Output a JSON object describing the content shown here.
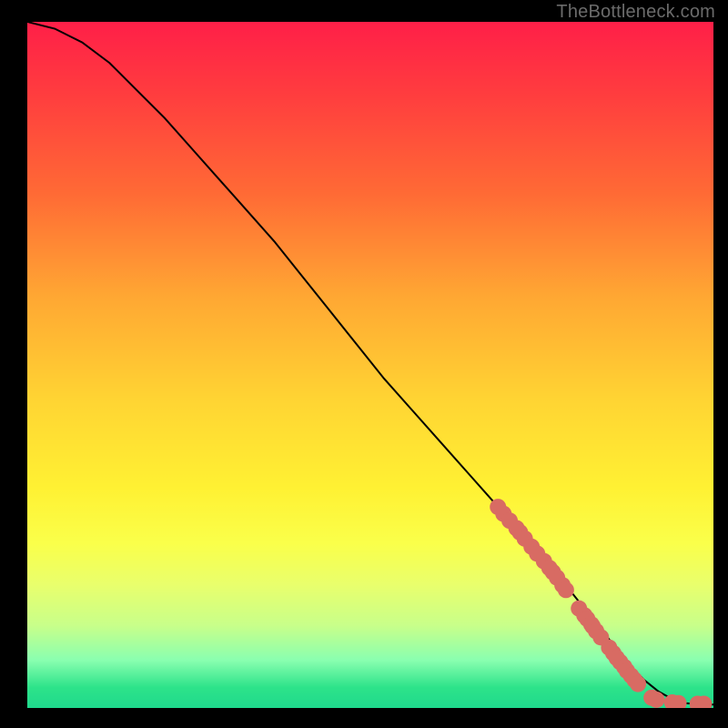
{
  "attribution": "TheBottleneck.com",
  "chart_data": {
    "type": "line",
    "title": "",
    "xlabel": "",
    "ylabel": "",
    "xlim": [
      0,
      100
    ],
    "ylim": [
      0,
      100
    ],
    "grid": false,
    "series": [
      {
        "name": "curve",
        "color": "#000000",
        "x": [
          0,
          4,
          8,
          12,
          16,
          20,
          24,
          28,
          32,
          36,
          40,
          44,
          48,
          52,
          56,
          60,
          64,
          68,
          72,
          76,
          80,
          82,
          84,
          86,
          88,
          90,
          92,
          94,
          96,
          98,
          100
        ],
        "y": [
          100,
          99,
          97,
          94,
          90,
          86,
          81.5,
          77,
          72.5,
          68,
          63,
          58,
          53,
          48,
          43.5,
          39,
          34.5,
          30,
          25.5,
          21,
          16,
          13.5,
          11,
          8.5,
          6,
          4,
          2.4,
          1.3,
          0.7,
          0.5,
          0.5
        ]
      }
    ],
    "points": [
      {
        "name": "cluster-upper",
        "color": "#d86b63",
        "x": [
          68.6,
          69.4,
          70.3,
          71.3,
          71.8,
          72.5,
          73.5,
          74.3,
          75.3,
          76.1,
          76.6,
          77.2,
          78.0,
          78.5
        ],
        "y": [
          29.3,
          28.3,
          27.3,
          26.2,
          25.6,
          24.7,
          23.5,
          22.5,
          21.4,
          20.4,
          19.8,
          19.0,
          17.9,
          17.2
        ]
      },
      {
        "name": "cluster-mid",
        "color": "#d86b63",
        "x": [
          80.4,
          81.2,
          81.6,
          82.2,
          82.4,
          82.9,
          83.6
        ],
        "y": [
          14.5,
          13.5,
          13.0,
          12.2,
          11.9,
          11.2,
          10.3
        ]
      },
      {
        "name": "cluster-lower",
        "color": "#d86b63",
        "x": [
          84.8,
          85.4,
          85.9,
          86.4,
          87.0,
          87.4,
          88.0,
          88.5,
          89.0
        ],
        "y": [
          8.8,
          8.0,
          7.3,
          6.7,
          6.0,
          5.4,
          4.7,
          4.1,
          3.5
        ]
      },
      {
        "name": "tail",
        "color": "#d86b63",
        "x": [
          91.0,
          91.7,
          94.0,
          94.9,
          97.7,
          98.6
        ],
        "y": [
          1.5,
          1.2,
          0.8,
          0.7,
          0.6,
          0.6
        ]
      }
    ]
  }
}
